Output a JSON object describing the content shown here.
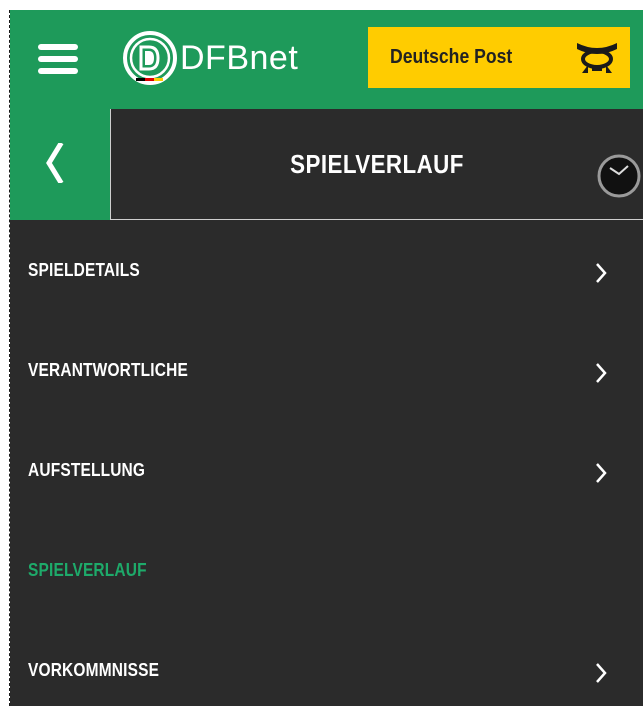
{
  "header": {
    "logo_text": "DFBnet",
    "sponsor_text": "Deutsche Post"
  },
  "subheader": {
    "title": "SPIELVERLAUF"
  },
  "menu": {
    "items": [
      {
        "label": "SPIELDETAILS",
        "active": false,
        "has_chevron": true
      },
      {
        "label": "VERANTWORTLICHE",
        "active": false,
        "has_chevron": true
      },
      {
        "label": "AUFSTELLUNG",
        "active": false,
        "has_chevron": true
      },
      {
        "label": "SPIELVERLAUF",
        "active": true,
        "has_chevron": false
      },
      {
        "label": "VORKOMMNISSE",
        "active": false,
        "has_chevron": true
      }
    ]
  },
  "icons": {
    "menu": "hamburger-icon",
    "logo": "dfb-logo-icon",
    "sponsor": "posthorn-icon",
    "back": "chevron-left-icon",
    "timer": "stopwatch-icon",
    "item_arrow": "chevron-right-icon"
  },
  "colors": {
    "brand_green": "#1e9a5a",
    "active_text": "#1eaa6a",
    "background": "#2b2b2b",
    "sponsor_yellow": "#ffcc00"
  }
}
